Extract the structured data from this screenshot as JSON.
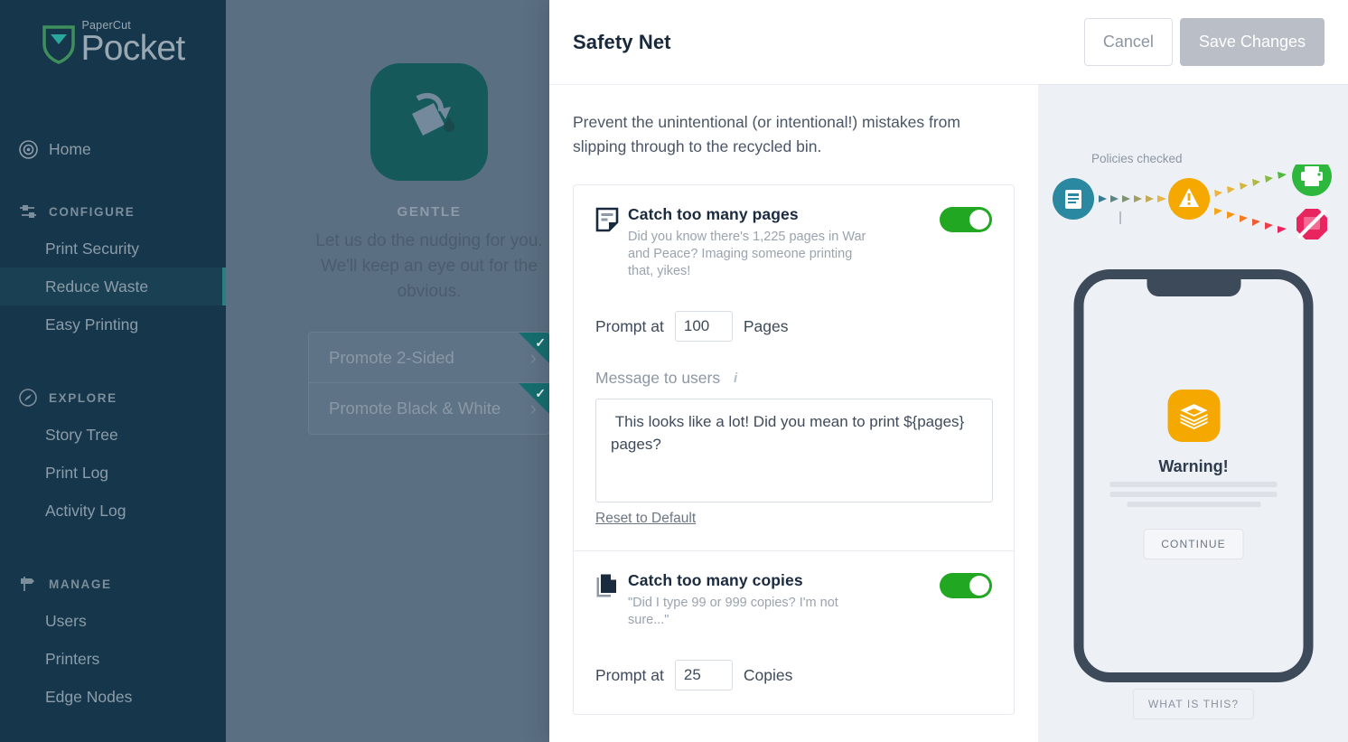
{
  "sidebar": {
    "logo": {
      "sup": "PaperCut",
      "main": "Pocket"
    },
    "home": {
      "label": "Home",
      "icon": "home-radar-icon"
    },
    "groups": [
      {
        "label": "CONFIGURE",
        "icon": "sliders-icon",
        "items": [
          {
            "label": "Print Security",
            "active": false
          },
          {
            "label": "Reduce Waste",
            "active": true
          },
          {
            "label": "Easy Printing",
            "active": false
          }
        ]
      },
      {
        "label": "EXPLORE",
        "icon": "compass-icon",
        "items": [
          {
            "label": "Story Tree",
            "active": false
          },
          {
            "label": "Print Log",
            "active": false
          },
          {
            "label": "Activity Log",
            "active": false
          }
        ]
      },
      {
        "label": "MANAGE",
        "icon": "signpost-icon",
        "items": [
          {
            "label": "Users",
            "active": false
          },
          {
            "label": "Printers",
            "active": false
          },
          {
            "label": "Edge Nodes",
            "active": false
          }
        ]
      }
    ]
  },
  "background": {
    "tile_icon": "watering-can-icon",
    "level_label": "GENTLE",
    "description": "Let us do the nudging for you. We'll keep an eye out for the obvious.",
    "cards": [
      {
        "label": "Promote 2-Sided",
        "checked": true
      },
      {
        "label": "Promote Black & White",
        "checked": true
      }
    ]
  },
  "panel": {
    "title": "Safety Net",
    "cancel_label": "Cancel",
    "save_label": "Save Changes",
    "intro": "Prevent the unintentional (or intentional!) mistakes from slipping through to the recycled bin.",
    "sections": [
      {
        "icon": "document-lines-icon",
        "title": "Catch too many pages",
        "subtitle": "Did you know there's 1,225 pages in War and Peace? Imaging someone printing that, yikes!",
        "toggle_on": true,
        "prompt_prefix": "Prompt at",
        "prompt_value": "100",
        "prompt_suffix": "Pages",
        "message_label": "Message to users",
        "message_value": " This looks like a lot! Did you mean to print ${pages} pages?",
        "reset_label": "Reset to Default"
      },
      {
        "icon": "copies-icon",
        "title": "Catch too many copies",
        "subtitle": "\"Did I type 99 or 999 copies? I'm not sure...\"",
        "toggle_on": true,
        "prompt_prefix": "Prompt at",
        "prompt_value": "25",
        "prompt_suffix": "Copies"
      }
    ]
  },
  "preview": {
    "flow_label": "Policies checked",
    "phone": {
      "app_icon": "paper-stack-icon",
      "warning_title": "Warning!",
      "continue_label": "CONTINUE"
    },
    "what_is_this_label": "WHAT IS THIS?"
  },
  "colors": {
    "sidebar_bg": "#16374b",
    "sidebar_active_bg": "#1a4053",
    "accent_teal": "#2a7f80",
    "toggle_on_green": "#22a722",
    "save_disabled": "#b9bec7",
    "preview_bg": "#edf0f5",
    "warning_orange": "#f5a800",
    "blocked_pink": "#e8255f",
    "print_green": "#2db83d",
    "doc_teal": "#2a88a0",
    "overlay_dim": "#5b6f82",
    "tile_green": "#15595a"
  }
}
